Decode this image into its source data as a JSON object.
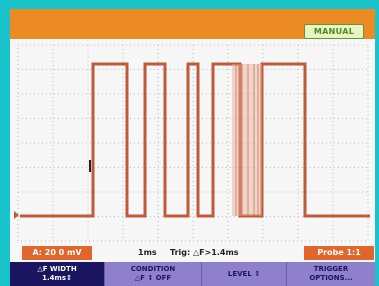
{
  "header": {
    "mode_label": "MANUAL"
  },
  "status": {
    "range": "A: 20 0 mV",
    "timebase": "1ms",
    "trigger": "Trig: △F>1.4ms",
    "probe": "Probe 1:1"
  },
  "softkeys": [
    {
      "line1": "△F WIDTH",
      "line2": "1.4ms↕"
    },
    {
      "line1": "CONDITION",
      "line2": "△F ↕ OFF"
    },
    {
      "line1": "LEVEL ↕",
      "line2": ""
    },
    {
      "line1": "TRIGGER",
      "line2": "OPTIONS..."
    }
  ],
  "colors": {
    "bezel": "#18c3cc",
    "top_bar": "#ec8a24",
    "trace": "#c05a3a",
    "trace_ghost": "#e8a890",
    "status_box": "#e0662c",
    "softkey_active": "#1b1560",
    "softkey_inactive": "#8f80cc"
  },
  "icons": {
    "trigger_marker": "trigger-arrow-icon",
    "channel_marker": "channel-ground-icon"
  }
}
